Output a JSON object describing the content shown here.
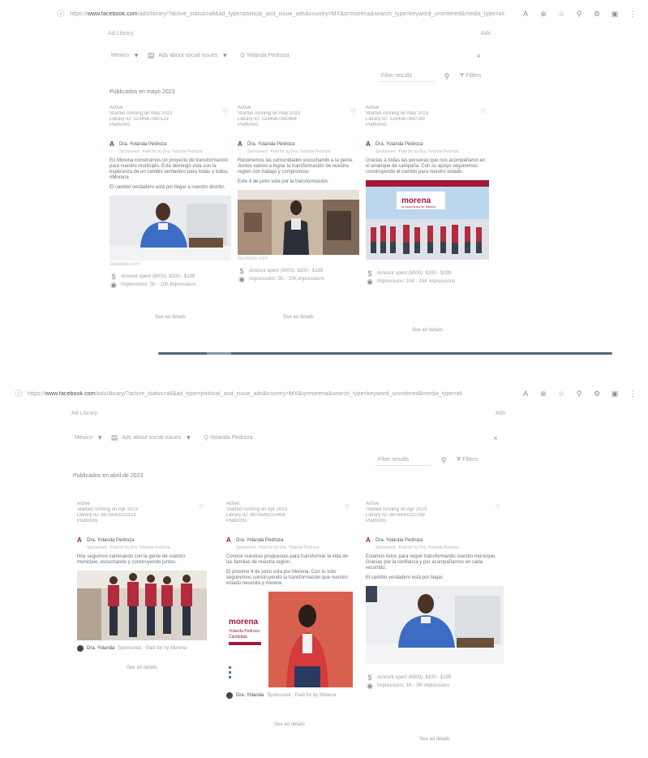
{
  "shot1": {
    "url_domain": "www.facebook.com",
    "url_rest": "/ads/library/?active_status=all&ad_type=political_and_issue_ads&country=MX&q=morena&search_type=keyword_unordered&media_type=all",
    "url_prefix": "https://",
    "top_right_label": "Ads",
    "sub_header": "Ad Library",
    "filter_country": "México",
    "filter_category": "Ads about social issues",
    "filter_query": "Q  Yolanda Pedroza",
    "search_placeholder": "Filter results",
    "filter_button": "Filters",
    "section_title": "Publicados en mayo 2023",
    "cards": [
      {
        "status": "Active",
        "started": "Started running on May 2023",
        "id": "Library ID: 1234567890123",
        "platform": "Platforms",
        "badge": "ⓘ",
        "author": "Dra. Yolanda Pedroza",
        "author_sub": "Sponsored · Paid for by Dra. Yolanda Pedroza",
        "text": "En Morena construimos un proyecto de transformación para nuestro municipio. Este domingo vota con la esperanza de un cambio verdadero para todas y todos. #Morena",
        "text2": "El cambio verdadero está por llegar a nuestro distrito.",
        "caption": "facebook.com",
        "spend": "Amount spent (MXN): $100 - $199",
        "impressions": "Impressions: 5K - 10K impressions",
        "button": "See ad details"
      },
      {
        "status": "Active",
        "started": "Started running on May 2023",
        "id": "Library ID: 1234567890456",
        "platform": "Platforms",
        "badge": "ⓘ",
        "author": "Dra. Yolanda Pedroza",
        "author_sub": "Sponsored · Paid for by Dra. Yolanda Pedroza",
        "text": "Recorremos las comunidades escuchando a la gente. Juntos vamos a lograr la transformación de nuestra región con trabajo y compromiso.",
        "text2": "Este 4 de junio vota por la transformación.",
        "caption": "facebook.com",
        "spend": "Amount spent (MXN): $100 - $199",
        "impressions": "Impressions: 5K - 10K impressions",
        "button": "See ad details"
      },
      {
        "status": "Active",
        "started": "Started running on May 2023",
        "id": "Library ID: 1234567890789",
        "platform": "Platforms",
        "badge": "ⓘ",
        "author": "Dra. Yolanda Pedroza",
        "author_sub": "Sponsored · Paid for by Dra. Yolanda Pedroza",
        "text": "Gracias a todas las personas que nos acompañaron en el arranque de campaña. Con su apoyo seguiremos construyendo el cambio para nuestro estado.",
        "text2": "",
        "banner": "morena",
        "banner_sub": "la esperanza de México",
        "caption": "",
        "spend": "Amount spent (MXN): $200 - $299",
        "impressions": "Impressions: 10K - 15K impressions",
        "button": "See ad details"
      }
    ]
  },
  "shot2": {
    "url_domain": "www.facebook.com",
    "url_rest": "/ads/library/?active_status=all&ad_type=political_and_issue_ads&country=MX&q=morena&search_type=keyword_unordered&media_type=all",
    "url_prefix": "https://",
    "top_right_label": "Ads",
    "sub_header": "Ad Library",
    "filter_country": "México",
    "filter_category": "Ads about social issues",
    "filter_query": "Q  Yolanda Pedroza",
    "search_placeholder": "Filter results",
    "filter_button": "Filters",
    "section_title": "Publicados en abril de 2023",
    "cards": [
      {
        "status": "Active",
        "started": "Started running on Apr 2023",
        "id": "Library ID: 9876543210123",
        "platform": "Platforms",
        "badge": "ⓘ",
        "author": "Dra. Yolanda Pedroza",
        "author_sub": "Sponsored · Paid for by Dra. Yolanda Pedroza",
        "text": "Hoy seguimos caminando con la gente de nuestro municipio, escuchando y construyendo juntos.",
        "footer_author": "Dra. Yolanda",
        "footer_meta": "Sponsored · Paid for by Morena",
        "button": "See ad details"
      },
      {
        "status": "Active",
        "started": "Started running on Apr 2023",
        "id": "Library ID: 9876543210456",
        "platform": "Platforms",
        "badge": "ⓘ",
        "author": "Dra. Yolanda Pedroza",
        "author_sub": "Sponsored · Paid for by Dra. Yolanda Pedroza",
        "text": "Conoce nuestras propuestas para transformar la vida de las familias de nuestra región.",
        "text2": "El próximo 4 de junio vota por Morena. Con tu voto seguiremos construyendo la transformación que nuestro estado necesita y merece.",
        "poster_brand": "morena",
        "poster_line1": "Yolanda Pedroza",
        "poster_line2": "Candidata",
        "footer_author": "Dra. Yolanda",
        "footer_meta": "Sponsored · Paid for by Morena",
        "button": "See ad details"
      },
      {
        "status": "Active",
        "started": "Started running on Apr 2023",
        "id": "Library ID: 9876543210789",
        "platform": "Platforms",
        "badge": "ⓘ",
        "author": "Dra. Yolanda Pedroza",
        "author_sub": "Sponsored · Paid for by Dra. Yolanda Pedroza",
        "text": "Estamos listos para seguir transformando nuestro municipio. Gracias por la confianza y por acompañarnos en cada recorrido.",
        "text2": "El cambio verdadero está por llegar.",
        "spend": "Amount spent (MXN): $100 - $199",
        "impressions": "Impressions: 1K - 5K impressions",
        "button": "See ad details"
      }
    ]
  },
  "colors": {
    "scrollbar": "#55657f",
    "brand": "#a3173b",
    "load_line": "#e0b9a6"
  }
}
